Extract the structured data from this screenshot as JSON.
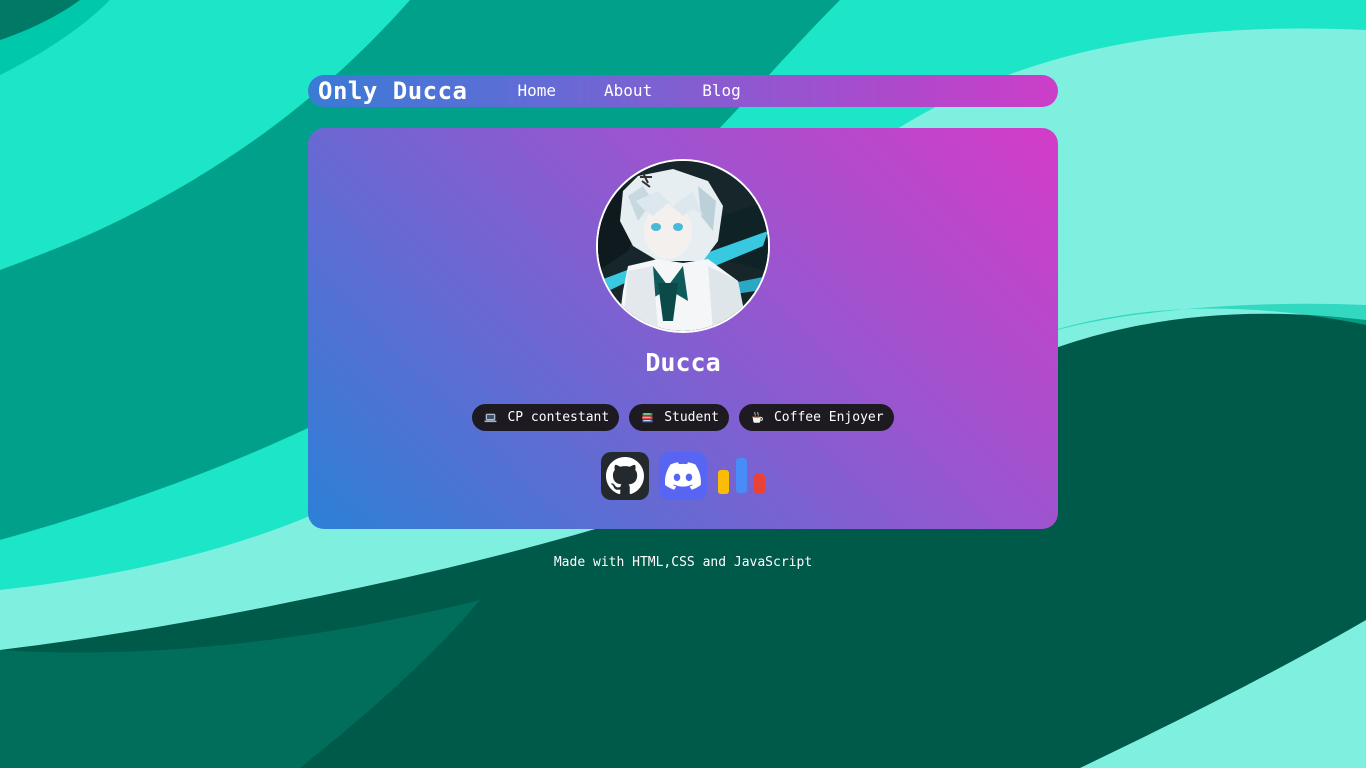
{
  "header": {
    "brand": "Only Ducca",
    "nav": [
      {
        "label": "Home"
      },
      {
        "label": "About"
      },
      {
        "label": "Blog"
      }
    ]
  },
  "profile": {
    "name": "Ducca",
    "avatar_icon": "anime-avatar-image",
    "tags": [
      {
        "icon": "laptop-icon",
        "label": "CP contestant"
      },
      {
        "icon": "books-icon",
        "label": "Student"
      },
      {
        "icon": "coffee-icon",
        "label": "Coffee Enjoyer"
      }
    ],
    "socials": [
      {
        "icon": "github-icon"
      },
      {
        "icon": "discord-icon"
      },
      {
        "icon": "stats-icon"
      }
    ]
  },
  "footer": {
    "text": "Made with HTML,CSS and JavaScript"
  },
  "colors": {
    "bg_dark": "#005a4a",
    "bg_teal": "#00a08a",
    "bg_mint": "#1de6c8",
    "bg_light": "#7ff0e0",
    "gradient_pink": "#d43cc8",
    "gradient_blue": "#2c80d6",
    "tag_bg": "#1d1a22"
  }
}
